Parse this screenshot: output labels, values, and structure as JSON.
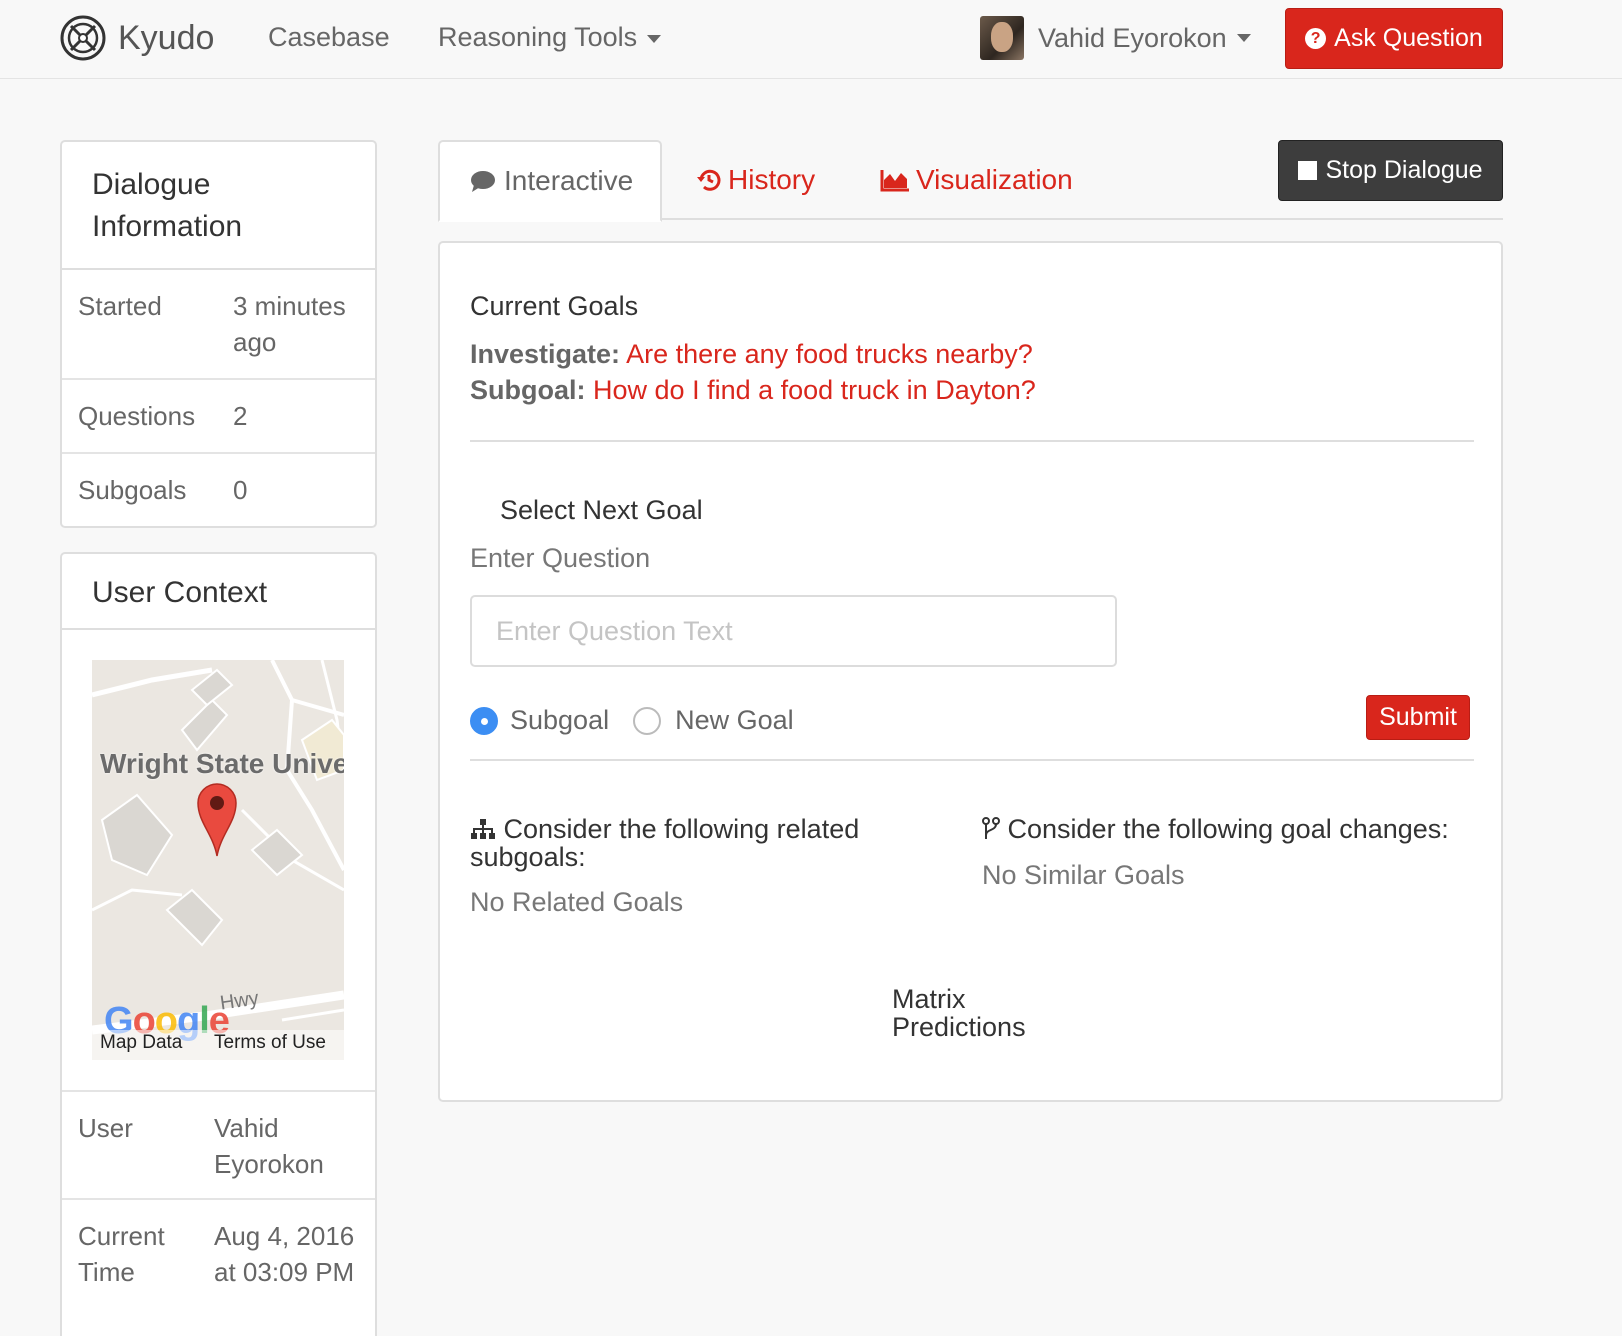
{
  "navbar": {
    "brand": "Kyudo",
    "links": [
      "Casebase",
      "Reasoning Tools"
    ],
    "user_name": "Vahid Eyorokon",
    "ask_button": "Ask Question"
  },
  "dialogue_info": {
    "title": "Dialogue Information",
    "rows": [
      {
        "label": "Started",
        "value": "3 minutes ago"
      },
      {
        "label": "Questions",
        "value": "2"
      },
      {
        "label": "Subgoals",
        "value": "0"
      }
    ]
  },
  "user_context": {
    "title": "User Context",
    "map": {
      "place_label": "Wright State University",
      "road_label": "Hwy",
      "map_data": "Map Data",
      "terms": "Terms of Use",
      "provider": "Google"
    },
    "rows": [
      {
        "label": "User",
        "value": "Vahid Eyorokon"
      },
      {
        "label": "Current Time",
        "value": "Aug 4, 2016 at 03:09 PM"
      }
    ]
  },
  "tabs": {
    "interactive": "Interactive",
    "history": "History",
    "visualization": "Visualization",
    "stop_button": "Stop Dialogue"
  },
  "main": {
    "current_goals_title": "Current Goals",
    "investigate_label": "Investigate:",
    "investigate_text": "Are there any food trucks nearby?",
    "subgoal_label": "Subgoal:",
    "subgoal_text": "How do I find a food truck in Dayton?",
    "select_next_goal": "Select Next Goal",
    "enter_question_label": "Enter Question",
    "enter_question_placeholder": "Enter Question Text",
    "radio_subgoal": "Subgoal",
    "radio_new_goal": "New Goal",
    "submit": "Submit",
    "related_title": "Consider the following related subgoals:",
    "related_empty": "No Related Goals",
    "changes_title": "Consider the following goal changes:",
    "changes_empty": "No Similar Goals",
    "matrix_title": "Matrix Predictions"
  },
  "colors": {
    "accent_red": "#d9261c",
    "stop_button": "#3d3d3d",
    "radio_selected": "#3c8ef3"
  }
}
